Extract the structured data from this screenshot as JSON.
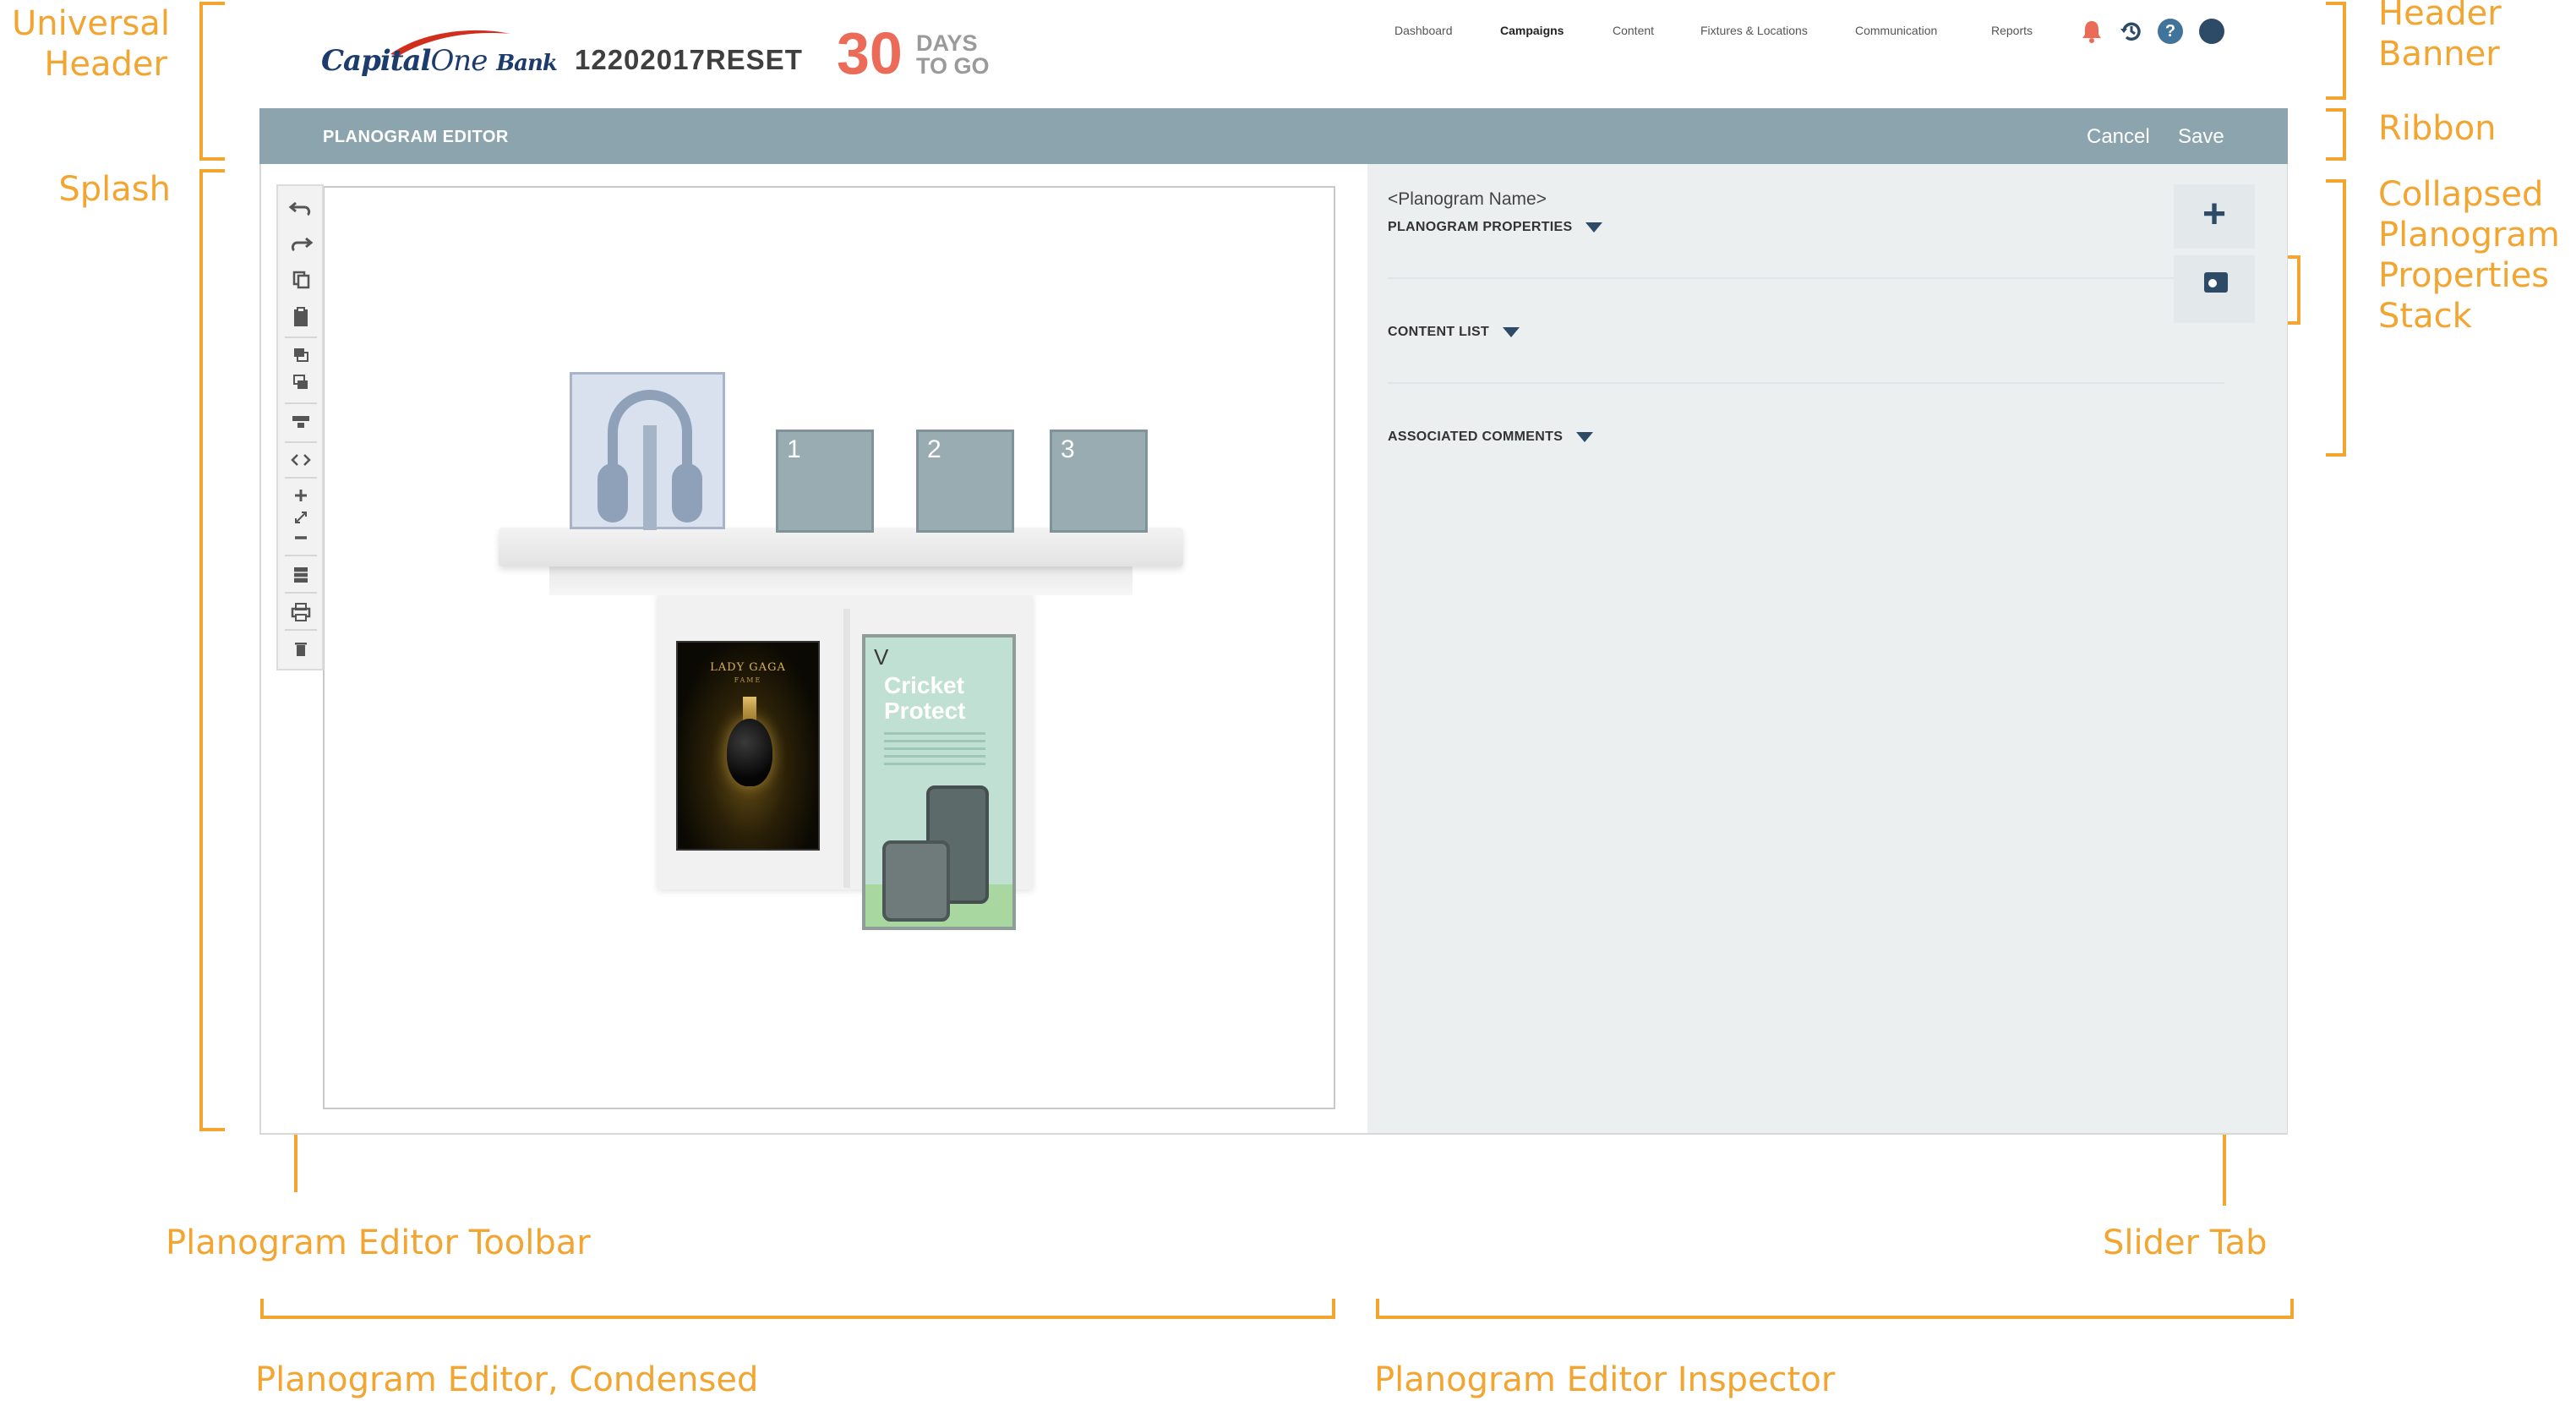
{
  "annotations": {
    "universal_header": "Universal\nHeader",
    "splash": "Splash",
    "header_banner": "Header\nBanner",
    "ribbon": "Ribbon",
    "collapsed_stack": "Collapsed\nPlanogram\nProperties\nStack",
    "toolbar": "Planogram Editor Toolbar",
    "slider_tab": "Slider Tab",
    "editor_condensed": "Planogram Editor, Condensed",
    "editor_inspector": "Planogram Editor Inspector"
  },
  "header": {
    "brand": "Capital",
    "brand_one": "One",
    "brand_bank": "Bank",
    "campaign_code": "12202017RESET",
    "days_count": "30",
    "days_label_1": "DAYS",
    "days_label_2": "TO GO",
    "nav": [
      "Dashboard",
      "Campaigns",
      "Content",
      "Fixtures & Locations",
      "Communication",
      "Reports"
    ],
    "active_nav": "Campaigns",
    "help_glyph": "?"
  },
  "ribbon": {
    "title": "PLANOGRAM EDITOR",
    "cancel_label": "Cancel",
    "save_label": "Save"
  },
  "toolbar": {
    "items": [
      "undo-icon",
      "redo-icon",
      "copy-icon",
      "paste-icon",
      "duplicate-icon",
      "align-icon",
      "code-icon",
      "zoom-in-icon",
      "zoom-fit-icon",
      "zoom-out-icon",
      "grid-icon",
      "print-icon",
      "delete-icon"
    ]
  },
  "canvas": {
    "slots": [
      "1",
      "2",
      "3"
    ],
    "gaga_title": "LADY GAGA",
    "gaga_sub": "FAME",
    "cricket_letter": "V",
    "cricket_headline_1": "Cricket",
    "cricket_headline_2": "Protect"
  },
  "inspector": {
    "planogram_name": "<Planogram Name>",
    "sections": [
      "PLANOGRAM PROPERTIES",
      "CONTENT LIST",
      "ASSOCIATED COMMENTS"
    ],
    "add_glyph": "+"
  },
  "colors": {
    "annotation": "#f2a531",
    "ribbon": "#8ba4ad",
    "inspector_bg": "#ebeff0",
    "accent_red": "#ec6a58",
    "brand_blue": "#1d3c6e"
  }
}
